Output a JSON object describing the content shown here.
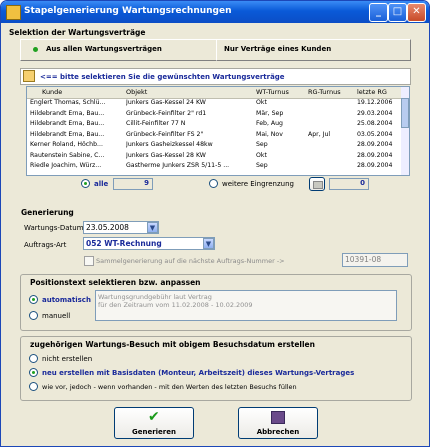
{
  "window": {
    "title": "Stapelgenerierung Wartungsrechnungen"
  },
  "selection": {
    "heading": "Selektion der Wartungsverträge",
    "option_all": "Aus allen Wartungsverträgen",
    "option_customer": "Nur Verträge eines Kunden",
    "hint": "<== bitte selektieren Sie die gewünschten Wartungsverträge",
    "columns": [
      "Kunde",
      "Objekt",
      "WT-Turnus",
      "RG-Turnus",
      "letzte RG"
    ],
    "rows": [
      {
        "kunde": "Englert Thomas, Schlü...",
        "objekt": "Junkers Gas-Kessel 24 KW",
        "wt": "Okt",
        "rg": "",
        "letzte": "19.12.2006",
        "selected": false
      },
      {
        "kunde": "Hildebrandt Erna, Bau...",
        "objekt": "Grünbeck-Feinfilter 2\" rd1",
        "wt": "Mär, Sep",
        "rg": "",
        "letzte": "29.03.2004",
        "selected": false
      },
      {
        "kunde": "Hildebrandt Erna, Bau...",
        "objekt": "Cillit-Feinfilter 77 N",
        "wt": "Feb, Aug",
        "rg": "",
        "letzte": "25.08.2004",
        "selected": false
      },
      {
        "kunde": "Hildebrandt Erna, Bau...",
        "objekt": "Grünbeck-Feinfilter FS 2\"",
        "wt": "Mai, Nov",
        "rg": "Apr, Jul",
        "letzte": "03.05.2004",
        "selected": false
      },
      {
        "kunde": "Kerner Roland, Höchb...",
        "objekt": "Junkers Gasheizkessel 48kw",
        "wt": "Sep",
        "rg": "",
        "letzte": "28.09.2004",
        "selected": false
      },
      {
        "kunde": "Rautenstein Sabine, C...",
        "objekt": "Junkers Gas-Kessel 28 KW",
        "wt": "Okt",
        "rg": "",
        "letzte": "28.09.2004",
        "selected": false
      },
      {
        "kunde": "Riedle Joachim, Würz...",
        "objekt": "Gastherme Junkers ZSR 5/11-5 ...",
        "wt": "Sep",
        "rg": "",
        "letzte": "28.09.2004",
        "selected": false
      }
    ],
    "filter_all": "alle",
    "count_all": "9",
    "filter_more": "weitere Eingrenzung",
    "count_more": "0"
  },
  "generation": {
    "heading": "Generierung",
    "date_label": "Wartungs-Datum",
    "date_value": "23.05.2008",
    "type_label": "Auftrags-Art",
    "type_value": "052 WT-Rechnung",
    "collective_label": "Sammelgenerierung auf die nächste Auftrags-Nummer ->",
    "order_number": "10391-08"
  },
  "position_text": {
    "heading": "Positionstext selektieren bzw. anpassen",
    "option_auto": "automatisch",
    "option_manual": "manuell",
    "text": "Wartungsgrundgebühr laut Vertrag\nfür den Zeitraum vom 11.02.2008 - 10.02.2009"
  },
  "visit": {
    "heading": "zugehörigen Wartungs-Besuch mit obigem Besuchsdatum erstellen",
    "option_none": "nicht erstellen",
    "option_new": "neu erstellen mit Basisdaten (Monteur, Arbeitszeit) dieses Wartungs-Vertrages",
    "option_prev": "wie vor, jedoch - wenn vorhanden - mit den Werten des letzten Besuchs füllen"
  },
  "buttons": {
    "generate": "Generieren",
    "cancel": "Abbrechen"
  }
}
